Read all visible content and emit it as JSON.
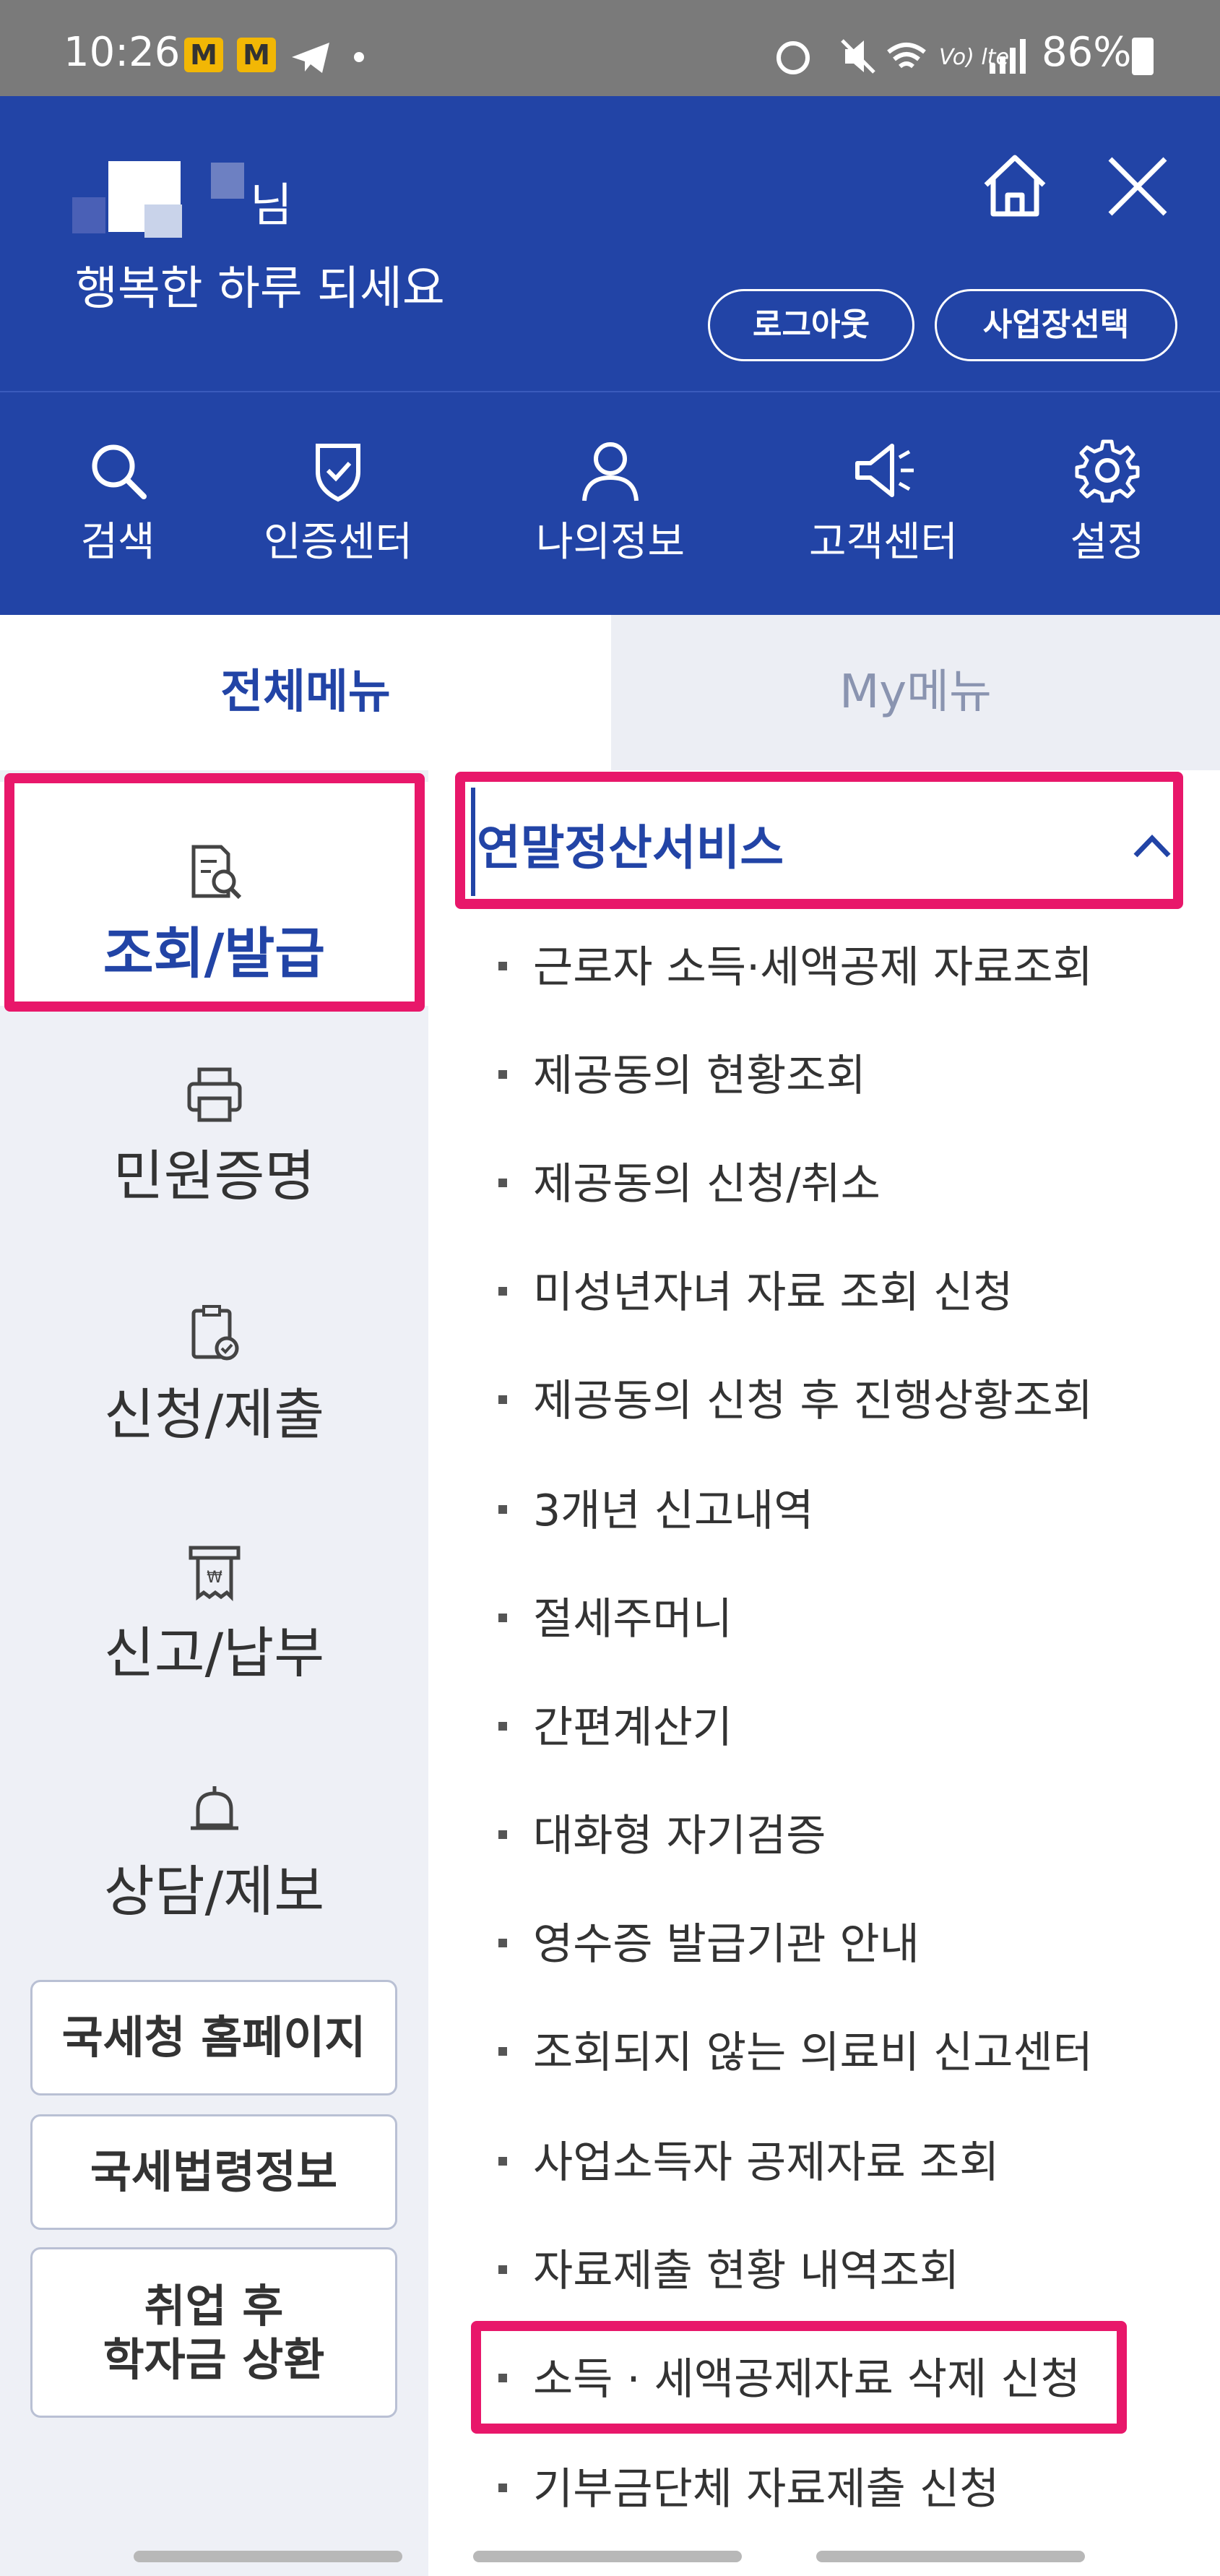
{
  "status_bar": {
    "time": "10:26",
    "badge1": "M",
    "badge2": "M",
    "signal_text": "Vo) lte",
    "battery": "86%"
  },
  "header": {
    "user_suffix": "님",
    "greeting": "행복한 하루 되세요",
    "logout_label": "로그아웃",
    "site_select_label": "사업장선택"
  },
  "quick_nav": [
    {
      "label": "검색",
      "icon": "search-icon"
    },
    {
      "label": "인증센터",
      "icon": "shield-check-icon"
    },
    {
      "label": "나의정보",
      "icon": "user-icon"
    },
    {
      "label": "고객센터",
      "icon": "megaphone-icon"
    },
    {
      "label": "설정",
      "icon": "gear-icon"
    }
  ],
  "tabs": {
    "all": "전체메뉴",
    "my": "My메뉴"
  },
  "categories": [
    {
      "label": "조회/발급",
      "icon": "document-search-icon"
    },
    {
      "label": "민원증명",
      "icon": "printer-icon"
    },
    {
      "label": "신청/제출",
      "icon": "clipboard-check-icon"
    },
    {
      "label": "신고/납부",
      "icon": "receipt-icon"
    },
    {
      "label": "상담/제보",
      "icon": "bell-icon"
    }
  ],
  "side_buttons": {
    "nts_home": "국세청 홈페이지",
    "tax_law": "국세법령정보",
    "student_loan_line1": "취업 후",
    "student_loan_line2": "학자금 상환"
  },
  "section": {
    "title": "연말정산서비스"
  },
  "menu_items": [
    "근로자 소득·세액공제 자료조회",
    "제공동의 현황조회",
    "제공동의 신청/취소",
    "미성년자녀 자료 조회 신청",
    "제공동의 신청 후 진행상황조회",
    "3개년 신고내역",
    "절세주머니",
    "간편계산기",
    "대화형 자기검증",
    "영수증 발급기관 안내",
    "조회되지 않는 의료비 신고센터",
    "사업소득자 공제자료 조회",
    "자료제출 현황 내역조회",
    "소득 · 세액공제자료 삭제 신청",
    "기부금단체 자료제출 신청"
  ],
  "colors": {
    "brand_blue": "#2244a6",
    "highlight": "#e8176a",
    "left_bg": "#eef0f6"
  }
}
